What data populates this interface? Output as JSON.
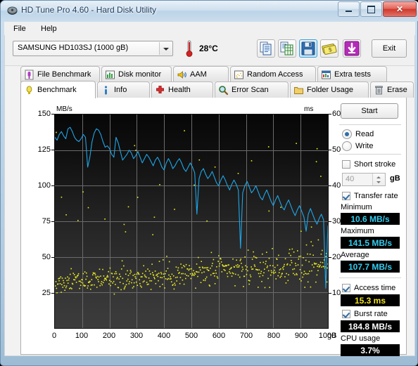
{
  "window": {
    "title": "HD Tune Pro 4.60 - Hard Disk Utility",
    "minimize_label": "",
    "maximize_label": "",
    "close_label": "✕"
  },
  "menu": {
    "items": [
      {
        "label": "File"
      },
      {
        "label": "Help"
      }
    ]
  },
  "toolbar": {
    "drive": "SAMSUNG HD103SJ (1000 gB)",
    "temperature": "28°C",
    "buttons": [
      {
        "name": "copy-icon",
        "title": "Copy"
      },
      {
        "name": "export-excel-icon",
        "title": "Export"
      },
      {
        "name": "save-icon",
        "title": "Save",
        "selected": true
      },
      {
        "name": "money-icon",
        "title": "Buy"
      },
      {
        "name": "download-icon",
        "title": "Download"
      }
    ],
    "exit_label": "Exit"
  },
  "tabs_row1": [
    {
      "label": "File Benchmark",
      "icon": "file-benchmark-icon"
    },
    {
      "label": "Disk monitor",
      "icon": "disk-monitor-icon"
    },
    {
      "label": "AAM",
      "icon": "speaker-icon"
    },
    {
      "label": "Random Access",
      "icon": "random-access-icon"
    },
    {
      "label": "Extra tests",
      "icon": "extra-tests-icon"
    }
  ],
  "tabs_row2": [
    {
      "label": "Benchmark",
      "icon": "benchmark-icon",
      "active": true
    },
    {
      "label": "Info",
      "icon": "info-icon",
      "active": false
    },
    {
      "label": "Health",
      "icon": "health-icon",
      "active": false
    },
    {
      "label": "Error Scan",
      "icon": "error-scan-icon",
      "active": false
    },
    {
      "label": "Folder Usage",
      "icon": "folder-icon",
      "active": false
    },
    {
      "label": "Erase",
      "icon": "erase-icon",
      "active": false
    }
  ],
  "controls": {
    "start_label": "Start",
    "read_label": "Read",
    "write_label": "Write",
    "read_selected": true,
    "short_stroke_label": "Short stroke",
    "short_stroke_checked": false,
    "short_stroke_value": "40",
    "short_stroke_unit": "gB",
    "transfer_rate_label": "Transfer rate",
    "transfer_rate_checked": true,
    "access_time_label": "Access time",
    "access_time_checked": true,
    "burst_rate_label": "Burst rate",
    "burst_rate_checked": true
  },
  "results": {
    "minimum_label": "Minimum",
    "minimum_value": "10.6 MB/s",
    "maximum_label": "Maximum",
    "maximum_value": "141.5 MB/s",
    "average_label": "Average",
    "average_value": "107.7 MB/s",
    "access_time_value": "15.3 ms",
    "burst_rate_value": "184.8 MB/s",
    "cpu_usage_label": "CPU usage",
    "cpu_usage_value": "3.7%"
  },
  "chart_data": {
    "type": "line",
    "title": "",
    "xlabel": "gB",
    "ylabel": "MB/s",
    "y2label": "ms",
    "xlim": [
      0,
      1000
    ],
    "ylim": [
      0,
      150
    ],
    "y2lim": [
      0,
      60
    ],
    "xticks": [
      0,
      100,
      200,
      300,
      400,
      500,
      600,
      700,
      800,
      900,
      1000
    ],
    "yticks": [
      25,
      50,
      75,
      100,
      125,
      150
    ],
    "y2ticks": [
      10,
      20,
      30,
      40,
      50,
      60
    ],
    "grid": true,
    "legend": "none",
    "series": [
      {
        "name": "Transfer rate",
        "color": "#1ea6e8",
        "unit": "MB/s",
        "axis": "left",
        "x": [
          0,
          8,
          16,
          24,
          32,
          40,
          48,
          56,
          64,
          72,
          80,
          88,
          96,
          104,
          112,
          120,
          128,
          136,
          144,
          152,
          160,
          168,
          176,
          184,
          192,
          200,
          208,
          216,
          224,
          232,
          240,
          248,
          256,
          264,
          272,
          280,
          288,
          296,
          304,
          312,
          320,
          328,
          336,
          344,
          352,
          360,
          368,
          376,
          384,
          392,
          400,
          408,
          416,
          424,
          432,
          440,
          448,
          456,
          464,
          472,
          480,
          488,
          496,
          504,
          512,
          520,
          528,
          536,
          544,
          552,
          560,
          568,
          576,
          584,
          592,
          600,
          608,
          616,
          624,
          632,
          640,
          648,
          656,
          664,
          672,
          680,
          688,
          696,
          704,
          712,
          720,
          728,
          736,
          744,
          752,
          760,
          768,
          776,
          784,
          792,
          800,
          808,
          816,
          824,
          832,
          840,
          848,
          856,
          864,
          872,
          880,
          888,
          896,
          904,
          912,
          920,
          928,
          936,
          944,
          952,
          960,
          968,
          976,
          984,
          992,
          1000
        ],
        "y": [
          134,
          132,
          136,
          138,
          135,
          133,
          140,
          141,
          138,
          134,
          132,
          131,
          133,
          136,
          134,
          113,
          120,
          131,
          137,
          140,
          139,
          136,
          131,
          127,
          128,
          126,
          122,
          120,
          134,
          130,
          124,
          118,
          120,
          122,
          125,
          123,
          119,
          121,
          124,
          120,
          116,
          119,
          122,
          120,
          117,
          114,
          118,
          120,
          117,
          113,
          111,
          116,
          119,
          116,
          112,
          114,
          117,
          119,
          116,
          112,
          110,
          113,
          116,
          113,
          109,
          80,
          105,
          110,
          112,
          108,
          105,
          107,
          110,
          106,
          102,
          100,
          104,
          107,
          104,
          100,
          97,
          101,
          104,
          101,
          97,
          56,
          95,
          100,
          103,
          99,
          95,
          97,
          100,
          96,
          92,
          90,
          94,
          97,
          93,
          89,
          86,
          90,
          93,
          89,
          85,
          83,
          87,
          90,
          86,
          82,
          79,
          83,
          86,
          82,
          78,
          68,
          80,
          84,
          80,
          76,
          73,
          77,
          80,
          76,
          28,
          72,
          75,
          71,
          68,
          72
        ]
      },
      {
        "name": "Access time",
        "color": "#eeee22",
        "unit": "ms",
        "axis": "right",
        "points_count": 520,
        "mean_ms": 15.3,
        "trend": "rising from ~13 ms at 0 gB to ~18 ms at 1000 gB",
        "spread_ms": [
          7,
          22
        ]
      }
    ]
  }
}
